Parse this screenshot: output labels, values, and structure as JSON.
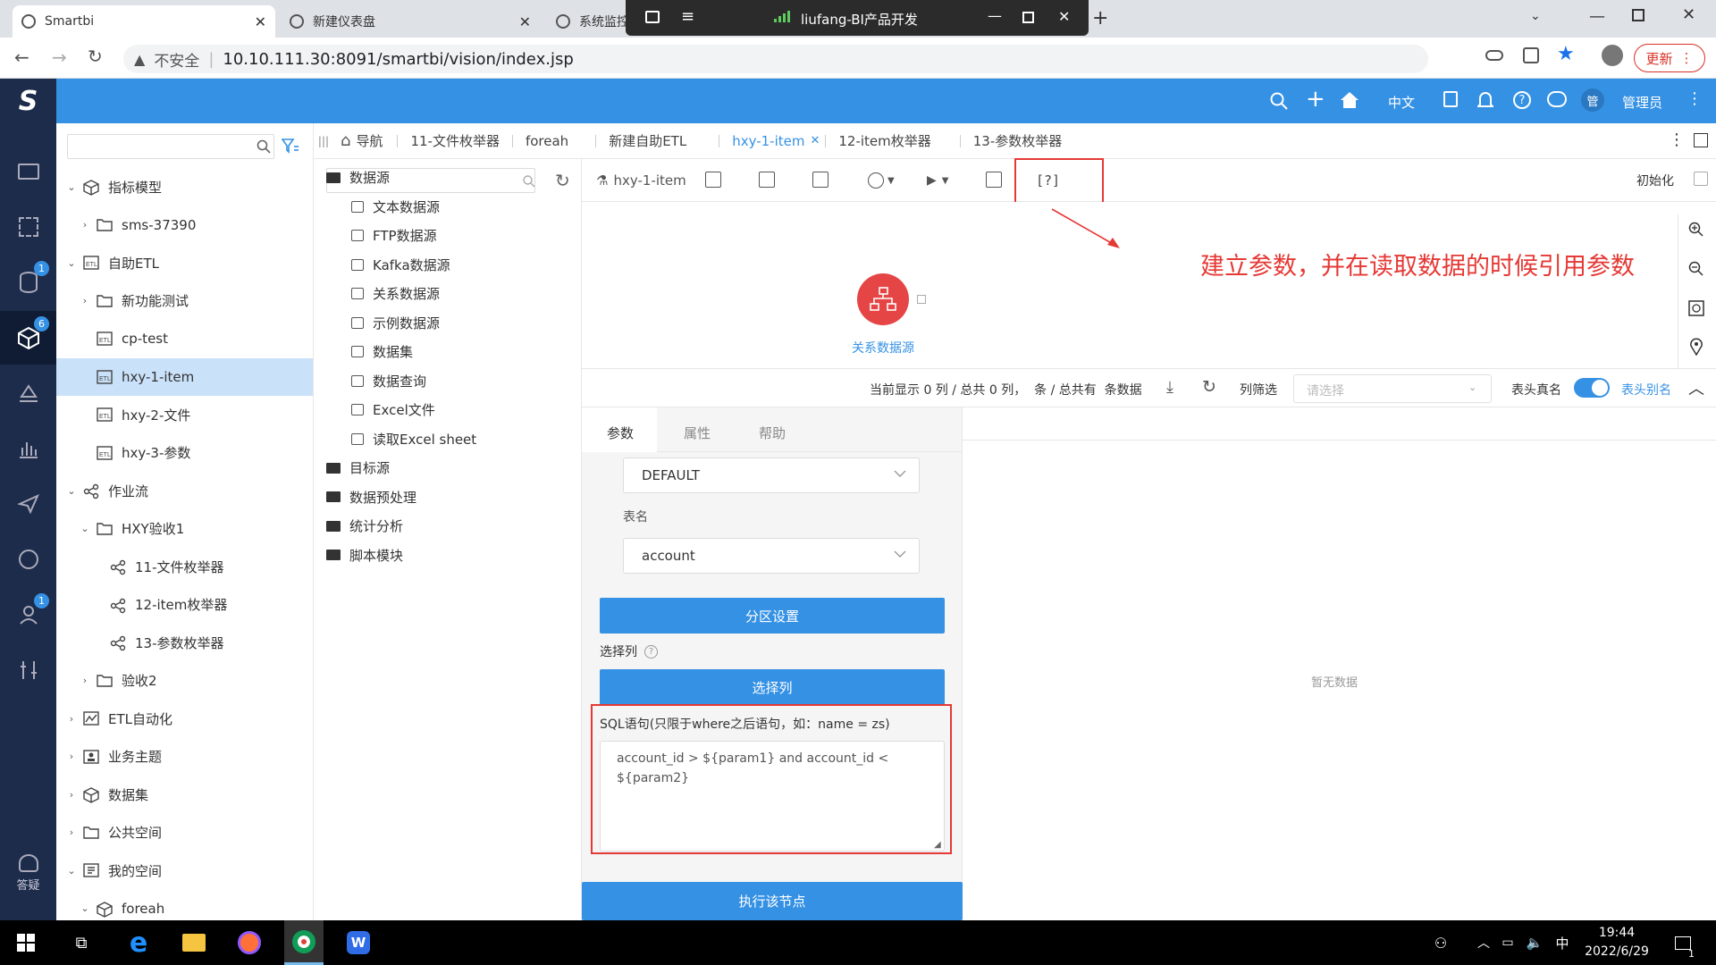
{
  "browser": {
    "tabs": [
      {
        "label": "Smartbi",
        "active": true
      },
      {
        "label": "新建仪表盘",
        "active": false
      },
      {
        "label": "系统监控",
        "active": false
      }
    ],
    "remote_title": "liufang-BI产品开发",
    "security_label": "不安全",
    "url": "10.10.111.30:8091/smartbi/vision/index.jsp",
    "update_label": "更新"
  },
  "header": {
    "lang": "中文",
    "avatar_text": "管",
    "user": "管理员"
  },
  "leftnav": {
    "badges": [
      "1",
      "6",
      "1"
    ],
    "help_label": "答疑"
  },
  "tree": {
    "search_placeholder": "",
    "items": [
      {
        "label": "指标模型",
        "expanded": true,
        "icon": "cube-icon"
      },
      {
        "label": "sms-37390",
        "icon": "folder-icon"
      },
      {
        "label": "自助ETL",
        "expanded": true,
        "icon": "etl-icon"
      },
      {
        "label": "新功能测试",
        "icon": "folder-icon"
      },
      {
        "label": "cp-test",
        "icon": "etl-icon"
      },
      {
        "label": "hxy-1-item",
        "icon": "etl-icon",
        "selected": true
      },
      {
        "label": "hxy-2-文件",
        "icon": "etl-icon"
      },
      {
        "label": "hxy-3-参数",
        "icon": "etl-icon"
      },
      {
        "label": "作业流",
        "expanded": true,
        "icon": "flow-icon"
      },
      {
        "label": "HXY验收1",
        "expanded": true,
        "icon": "folder-icon"
      },
      {
        "label": "11-文件枚举器",
        "icon": "flow-icon"
      },
      {
        "label": "12-item枚举器",
        "icon": "flow-icon"
      },
      {
        "label": "13-参数枚举器",
        "icon": "flow-icon"
      },
      {
        "label": "验收2",
        "icon": "folder-icon"
      },
      {
        "label": "ETL自动化",
        "icon": "chart-icon"
      },
      {
        "label": "业务主题",
        "icon": "theme-icon"
      },
      {
        "label": "数据集",
        "icon": "cube-icon"
      },
      {
        "label": "公共空间",
        "icon": "folder-icon"
      },
      {
        "label": "我的空间",
        "expanded": true,
        "icon": "space-icon"
      },
      {
        "label": "foreah",
        "icon": "cube-icon"
      }
    ]
  },
  "tabstrip": {
    "nav_label": "导航",
    "tabs": [
      "11-文件枚举器",
      "foreah",
      "新建自助ETL",
      "hxy-1-item",
      "12-item枚举器",
      "13-参数枚举器"
    ],
    "active_index": 3
  },
  "components": {
    "search_placeholder": "",
    "groups": [
      {
        "label": "数据源",
        "children": [
          "文本数据源",
          "FTP数据源",
          "Kafka数据源",
          "关系数据源",
          "示例数据源",
          "数据集",
          "数据查询",
          "Excel文件",
          "读取Excel sheet"
        ]
      },
      {
        "label": "目标源",
        "children": []
      },
      {
        "label": "数据预处理",
        "children": []
      },
      {
        "label": "统计分析",
        "children": []
      },
      {
        "label": "脚本模块",
        "children": []
      }
    ]
  },
  "toolbar": {
    "title": "hxy-1-item",
    "param_label": "[?]",
    "init_label": "初始化"
  },
  "canvas": {
    "annotation": "建立参数，并在读取数据的时候引用参数",
    "node_label": "关系数据源",
    "accent": "#e64545"
  },
  "gridbar": {
    "status": "当前显示 0 列 / 总共 0 列，  条 / 总共有  条数据",
    "filter_label": "列筛选",
    "filter_placeholder": "请选择",
    "real_name_label": "表头真名",
    "alias_label": "表头别名"
  },
  "props": {
    "tabs": [
      "参数",
      "属性",
      "帮助"
    ],
    "schema_value": "DEFAULT",
    "table_label": "表名",
    "table_value": "account",
    "partition_button": "分区设置",
    "select_cols_label": "选择列",
    "select_cols_button": "选择列",
    "sql_label": "SQL语句(只限于where之后语句，如：name = zs)",
    "sql_value": "account_id > ${param1} and account_id < ${param2}",
    "execute_button": "执行该节点"
  },
  "preview": {
    "empty_text": "暂无数据"
  },
  "taskbar": {
    "time": "19:44",
    "date": "2022/6/29",
    "ime": "中",
    "notif_count": "1"
  }
}
